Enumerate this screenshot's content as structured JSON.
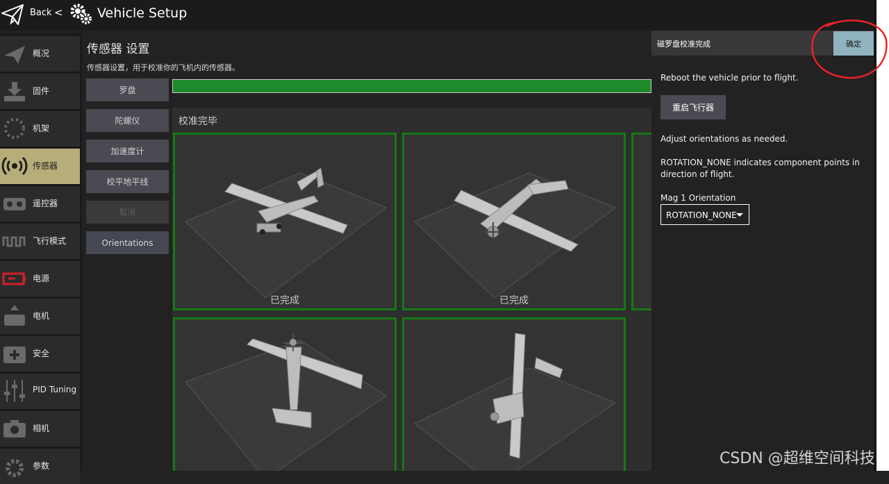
{
  "topbar": {
    "back_label": "Back",
    "separator": "<",
    "title": "Vehicle Setup"
  },
  "sidebar": {
    "items": [
      {
        "label": "概况",
        "icon": "plane-icon"
      },
      {
        "label": "固件",
        "icon": "download-icon"
      },
      {
        "label": "机架",
        "icon": "frame-icon"
      },
      {
        "label": "传感器",
        "icon": "sensor-icon",
        "active": true
      },
      {
        "label": "遥控器",
        "icon": "radio-icon"
      },
      {
        "label": "飞行模式",
        "icon": "wave-icon"
      },
      {
        "label": "电源",
        "icon": "battery-icon"
      },
      {
        "label": "电机",
        "icon": "motor-icon"
      },
      {
        "label": "安全",
        "icon": "medkit-icon"
      },
      {
        "label": "PID Tuning",
        "icon": "sliders-icon"
      },
      {
        "label": "相机",
        "icon": "camera-icon"
      },
      {
        "label": "参数",
        "icon": "gear-icon"
      }
    ]
  },
  "main": {
    "title": "传感器 设置",
    "description": "传感器设置，用于校准你的飞机内的传感器。",
    "buttons": {
      "compass": "罗盘",
      "gyro": "陀螺仪",
      "accel": "加速度计",
      "level": "校平地平线",
      "cancel": "取消",
      "orientations": "Orientations"
    },
    "progress": 1.0,
    "calibration": {
      "title": "校准完毕",
      "tiles": [
        {
          "status": "已完成"
        },
        {
          "status": "已完成"
        },
        {
          "status": ""
        },
        {
          "status": ""
        }
      ]
    }
  },
  "dialog": {
    "title": "磁罗盘校准完成",
    "ok_label": "确定",
    "reboot_text": "Reboot the vehicle prior to flight.",
    "reboot_button": "重启飞行器",
    "adjust_text": "Adjust orientations as needed.",
    "rotation_text": "ROTATION_NONE indicates component points in direction of flight.",
    "mag_label": "Mag 1 Orientation",
    "mag_value": "ROTATION_NONE"
  },
  "watermark": "CSDN @超维空间科技",
  "colors": {
    "background": "#222222",
    "active_nav": "#b7ad78",
    "progress_green": "#1f8a2b",
    "tile_border": "#167a14",
    "ok_button": "#8fb3bf",
    "annotation_red": "#e8232a"
  }
}
